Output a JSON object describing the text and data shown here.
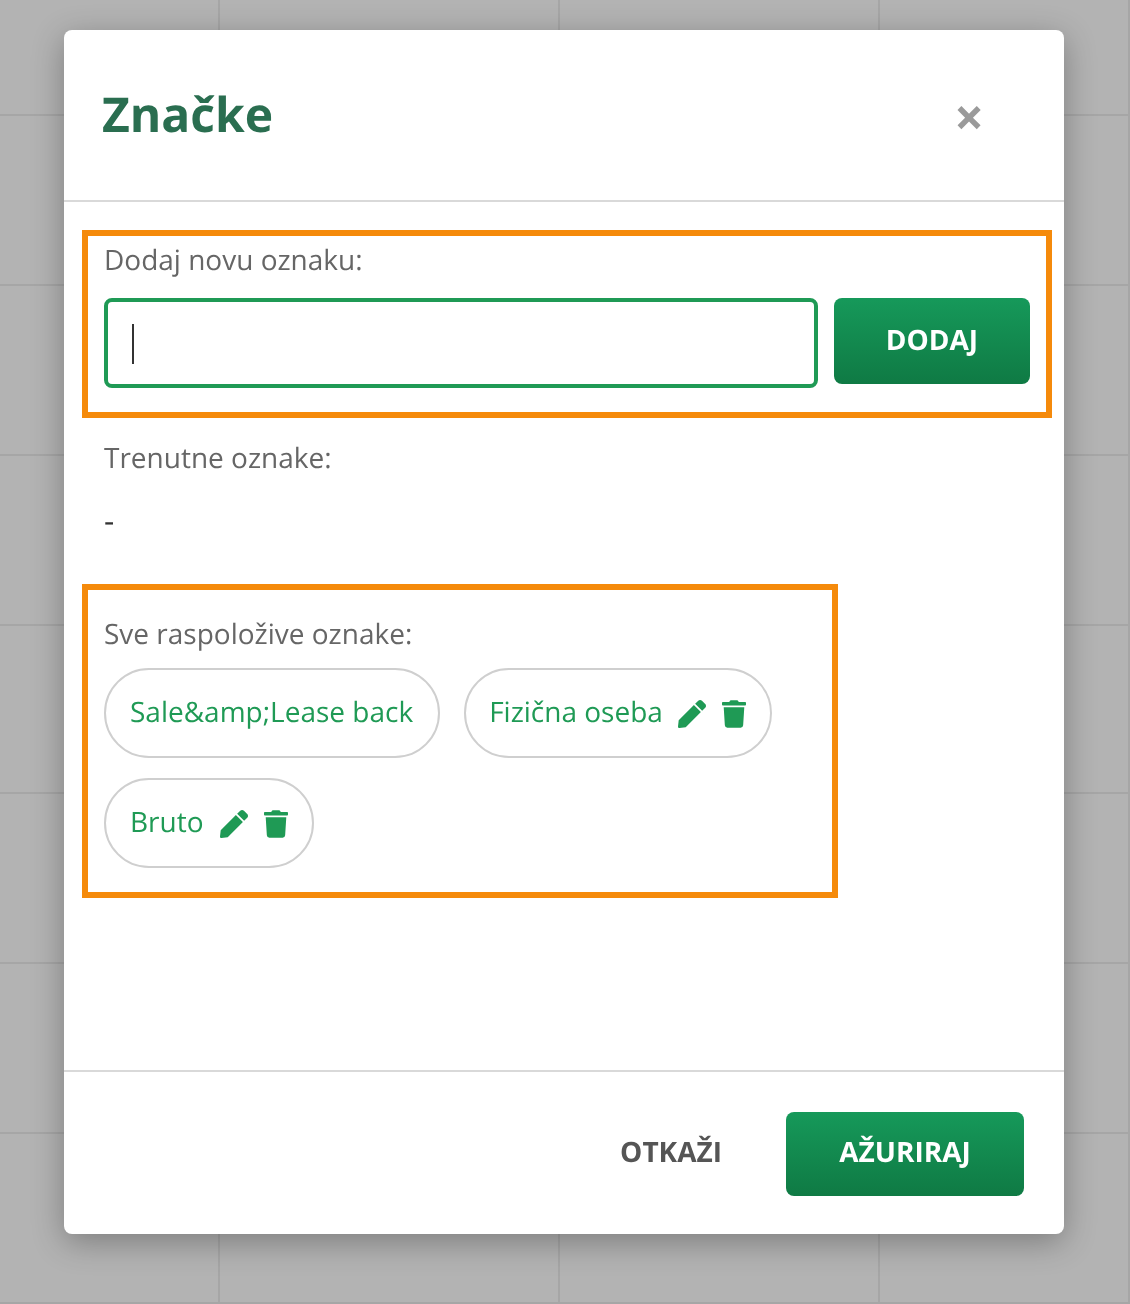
{
  "dialog": {
    "title": "Značke",
    "close_label": "×",
    "new_tag": {
      "label": "Dodaj novu oznaku:",
      "focused": true,
      "highlighted": true,
      "button": "DODAJ"
    },
    "current_tags": {
      "label": "Trenutne oznake:",
      "value": "-"
    },
    "available_tags": {
      "label": "Sve raspoložive oznake:",
      "highlighted": true,
      "tags": [
        {
          "label": "Sale&amp;Lease back",
          "editable": false
        },
        {
          "label": "Fizična oseba",
          "editable": true
        },
        {
          "label": "Bruto",
          "editable": true
        }
      ]
    },
    "buttons": [
      {
        "label": "OTKAŽI",
        "kind": "text"
      },
      {
        "label": "AŽURIRAJ",
        "kind": "primary"
      }
    ]
  }
}
